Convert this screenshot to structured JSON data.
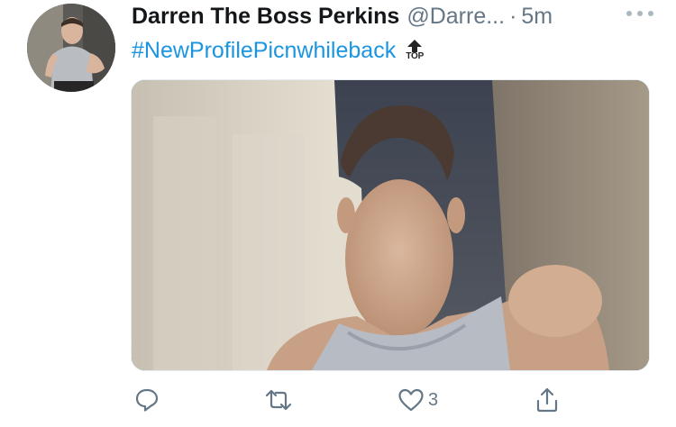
{
  "tweet": {
    "display_name": "Darren The Boss Perkins",
    "handle": "@Darre...",
    "separator": "·",
    "time": "5m",
    "hashtag": "#NewProfilePicnwhileback",
    "emoji": {
      "name": "top-arrow-icon",
      "label": "TOP"
    },
    "media": {
      "alt": "",
      "icon": "photo"
    },
    "actions": {
      "reply": {
        "icon": "reply-icon"
      },
      "retweet": {
        "icon": "retweet-icon"
      },
      "like": {
        "icon": "heart-icon",
        "count": "3"
      },
      "share": {
        "icon": "share-icon"
      }
    }
  },
  "colors": {
    "text_primary": "#14171a",
    "text_secondary": "#657786",
    "link": "#1b95e0",
    "background": "#ffffff"
  }
}
